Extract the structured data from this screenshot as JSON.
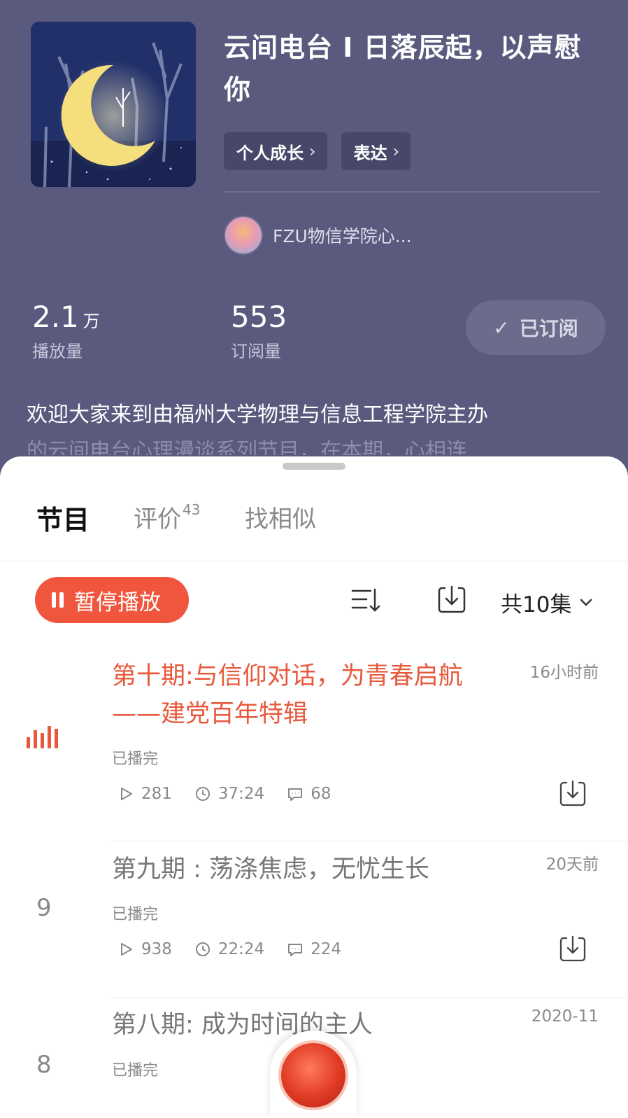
{
  "header": {
    "title": "云间电台 I 日落辰起，以声慰你",
    "tags": [
      {
        "label": "个人成长"
      },
      {
        "label": "表达"
      }
    ],
    "author": {
      "name": "FZU物信学院心..."
    },
    "stats": {
      "plays": {
        "value": "2.1",
        "unit": "万",
        "label": "播放量"
      },
      "subs": {
        "value": "553",
        "label": "订阅量"
      }
    },
    "subscribe_label": "已订阅",
    "description": "欢迎大家来到由福州大学物理与信息工程学院主办",
    "description_faded": "的云间电台心理漫谈系列节目，在本期，心相连"
  },
  "tabs": {
    "programs": "节目",
    "reviews": "评价",
    "reviews_count": "43",
    "similar": "找相似"
  },
  "toolbar": {
    "pause_label": "暂停播放",
    "count_label": "共10集"
  },
  "episodes": [
    {
      "index": "",
      "title": "第十期:与信仰对话，为青春启航——建党百年特辑",
      "time": "16小时前",
      "status": "已播完",
      "plays": "281",
      "duration": "37:24",
      "comments": "68",
      "playing": true
    },
    {
      "index": "9",
      "title": "第九期 : 荡涤焦虑，无忧生长",
      "time": "20天前",
      "status": "已播完",
      "plays": "938",
      "duration": "22:24",
      "comments": "224",
      "playing": false
    },
    {
      "index": "8",
      "title": "第八期: 成为时间的主人",
      "time": "2020-11",
      "status": "已播完",
      "plays": "",
      "duration": "",
      "comments": "",
      "playing": false
    }
  ],
  "colors": {
    "header_bg": "#5a5a7e",
    "accent": "#f0553e",
    "playing_text": "#e8593c"
  }
}
